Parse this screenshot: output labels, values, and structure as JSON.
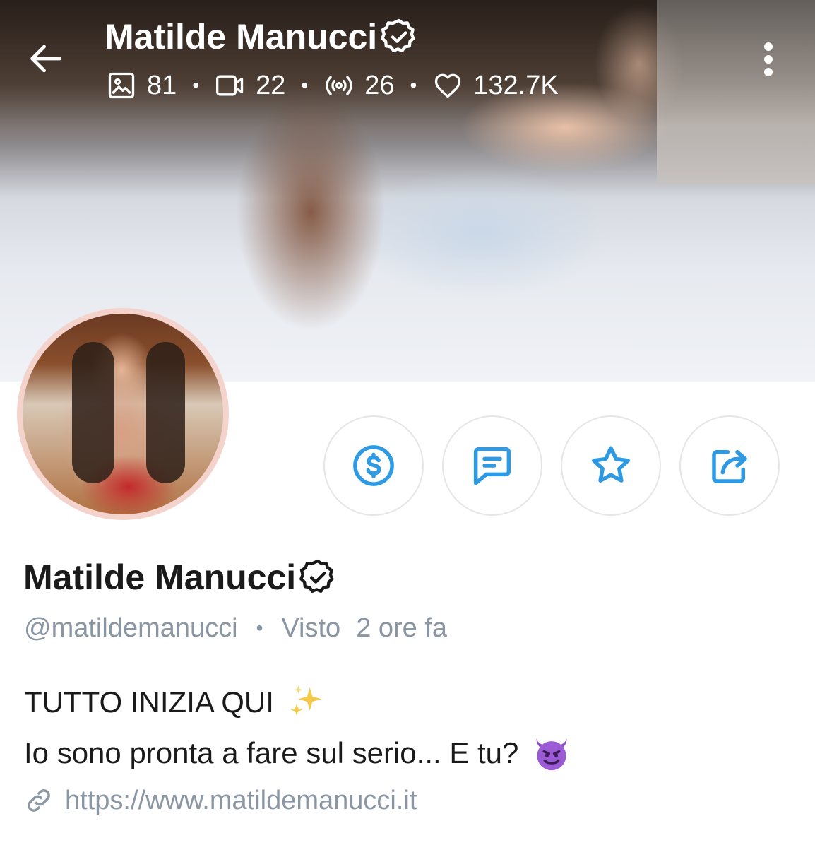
{
  "header": {
    "title": "Matilde Manucci",
    "stats": {
      "photos": "81",
      "videos": "22",
      "streams": "26",
      "likes": "132.7K"
    }
  },
  "profile": {
    "name": "Matilde Manucci",
    "username": "@matildemanucci",
    "seen_label": "Visto",
    "seen_time": "2 ore fa",
    "bio_line_1": "TUTTO INIZIA QUI",
    "bio_line_2": "Io sono pronta a fare sul serio... E tu?",
    "website": "https://www.matildemanucci.it"
  },
  "icons": {
    "back": "arrow-left-icon",
    "menu": "more-vertical-icon",
    "verified": "verified-badge-icon",
    "photos": "image-icon",
    "videos": "video-camera-icon",
    "streams": "broadcast-icon",
    "likes": "heart-icon",
    "tip": "dollar-circle-icon",
    "message": "chat-bubble-icon",
    "favorite": "star-icon",
    "share": "share-icon",
    "link": "link-icon"
  },
  "colors": {
    "accent": "#2e9ae3",
    "muted_text": "#8a96a3",
    "avatar_ring": "#f3d3cc"
  }
}
